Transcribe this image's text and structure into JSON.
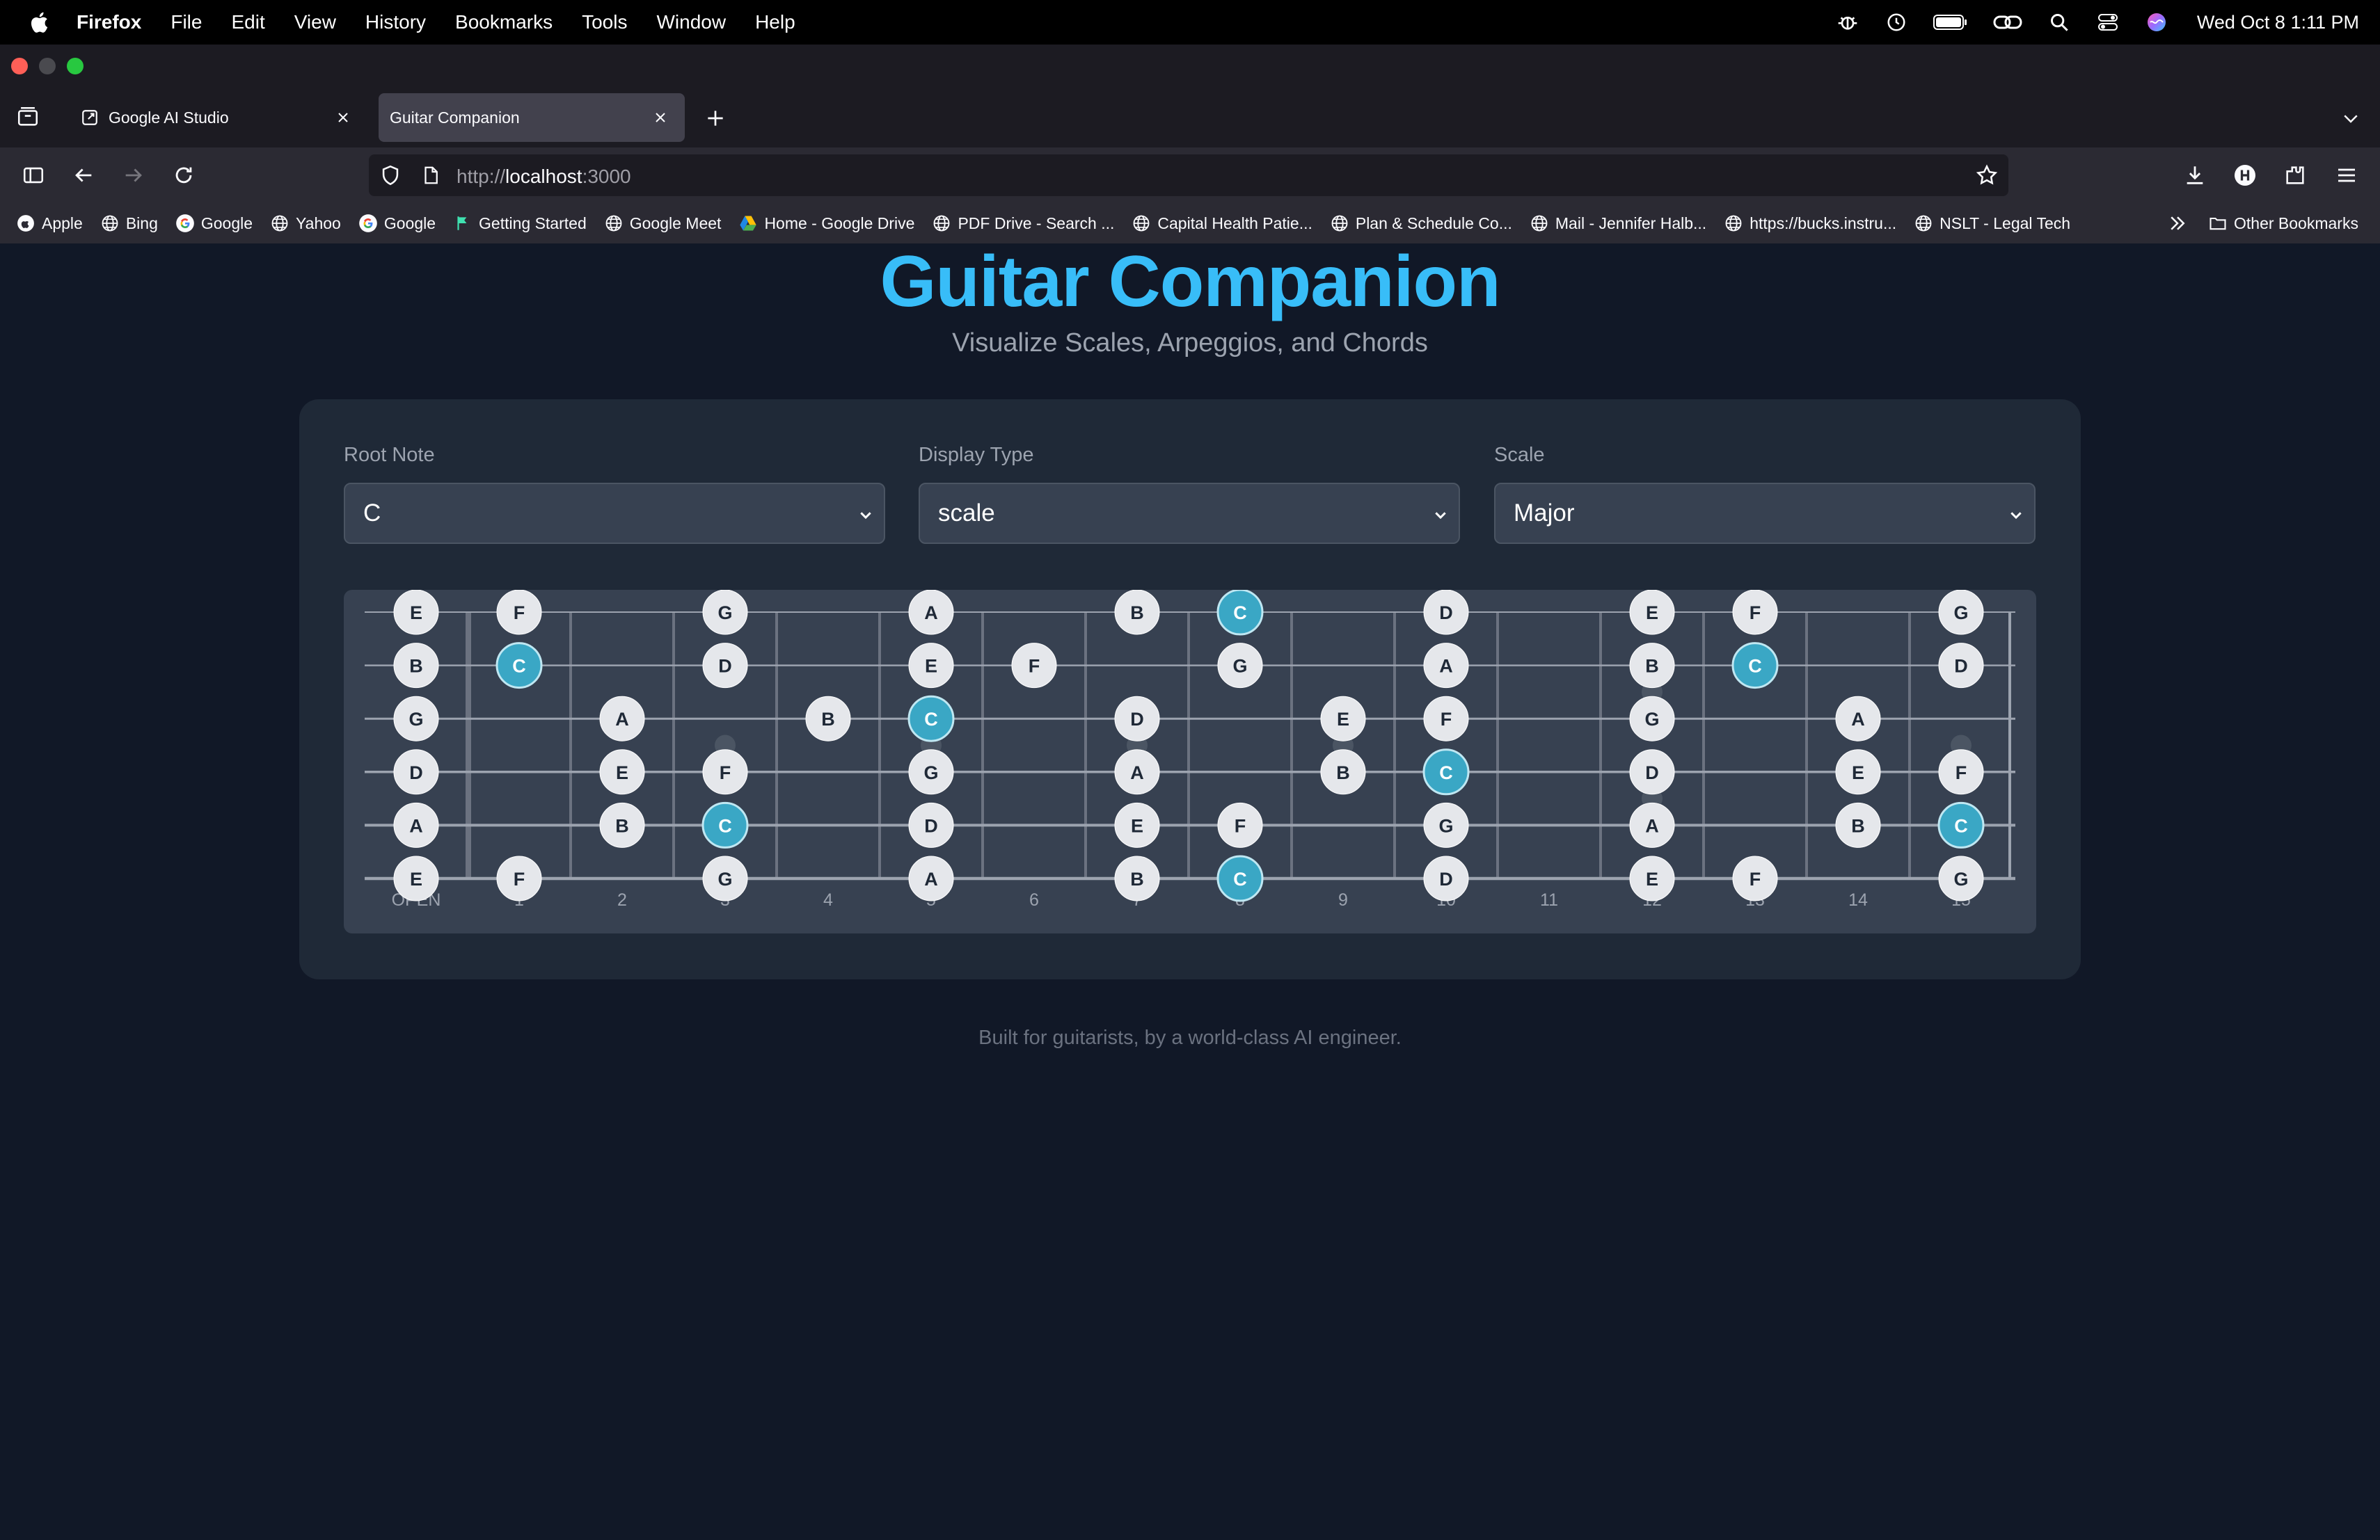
{
  "os_menubar": {
    "app_name": "Firefox",
    "menu_items": [
      "File",
      "Edit",
      "View",
      "History",
      "Bookmarks",
      "Tools",
      "Window",
      "Help"
    ],
    "clock": "Wed Oct 8  1:11 PM",
    "status_icons": [
      "bug-icon",
      "clock-icon",
      "battery-icon",
      "link-icon",
      "spotlight-icon",
      "control-center-icon",
      "siri-icon"
    ]
  },
  "browser": {
    "tabs": [
      {
        "title": "Google AI Studio",
        "active": false
      },
      {
        "title": "Guitar Companion",
        "active": true
      }
    ],
    "url": {
      "scheme": "http://",
      "host": "localhost",
      "port": ":3000"
    },
    "bookmarks": [
      {
        "label": "Apple",
        "icon": "apple-icon"
      },
      {
        "label": "Bing",
        "icon": "globe-icon"
      },
      {
        "label": "Google",
        "icon": "google-icon"
      },
      {
        "label": "Yahoo",
        "icon": "globe-icon"
      },
      {
        "label": "Google",
        "icon": "google-icon"
      },
      {
        "label": "Getting Started",
        "icon": "flag-icon"
      },
      {
        "label": "Google Meet",
        "icon": "globe-icon"
      },
      {
        "label": "Home - Google Drive",
        "icon": "drive-icon"
      },
      {
        "label": "PDF Drive - Search ...",
        "icon": "globe-icon"
      },
      {
        "label": "Capital Health Patie...",
        "icon": "globe-icon"
      },
      {
        "label": "Plan & Schedule Co...",
        "icon": "globe-icon"
      },
      {
        "label": "Mail - Jennifer Halb...",
        "icon": "globe-icon"
      },
      {
        "label": "https://bucks.instru...",
        "icon": "globe-icon"
      },
      {
        "label": "NSLT - Legal Tech",
        "icon": "globe-icon"
      }
    ],
    "other_bookmarks": "Other Bookmarks"
  },
  "page": {
    "title": "Guitar Companion",
    "subtitle": "Visualize Scales, Arpeggios, and Chords",
    "controls": {
      "root_label": "Root Note",
      "root_value": "C",
      "display_label": "Display Type",
      "display_value": "scale",
      "scale_label": "Scale",
      "scale_value": "Major"
    },
    "footer": "Built for guitarists, by a world-class AI engineer."
  },
  "fretboard": {
    "root": "C",
    "strings_high_to_low": [
      "E",
      "B",
      "G",
      "D",
      "A",
      "E"
    ],
    "scale_notes": [
      "C",
      "D",
      "E",
      "F",
      "G",
      "A",
      "B"
    ],
    "fret_labels": [
      "OPEN",
      "1",
      "2",
      "3",
      "4",
      "5",
      "6",
      "7",
      "8",
      "9",
      "10",
      "11",
      "12",
      "13",
      "14",
      "15"
    ],
    "inlay_frets": [
      3,
      5,
      7,
      9,
      12,
      15
    ]
  },
  "colors": {
    "title": "#38bdf8",
    "root_note": "#3aa7c5",
    "scale_note": "#e5e7eb",
    "page_bg": "#111827",
    "card_bg": "#1f2937"
  }
}
